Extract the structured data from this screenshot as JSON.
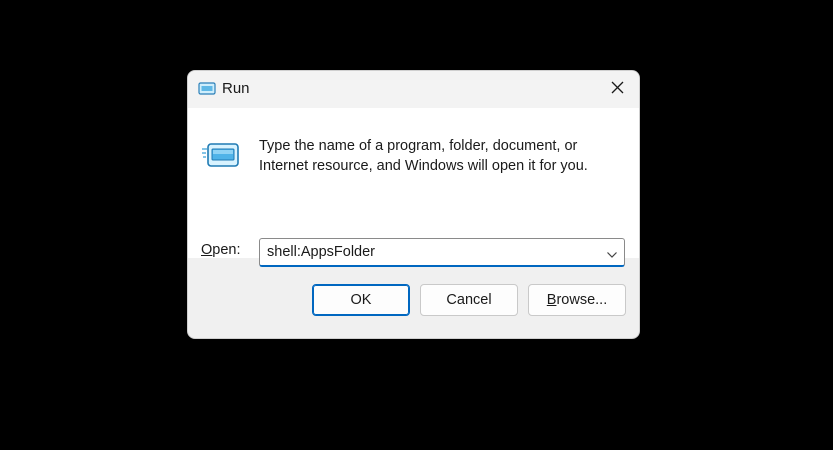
{
  "window": {
    "title": "Run",
    "title_icon": "run-app-icon",
    "close_icon": "close-icon"
  },
  "content": {
    "icon": "run-app-icon",
    "description": "Type the name of a program, folder, document, or Internet resource, and Windows will open it for you.",
    "open_label_accel": "O",
    "open_label_rest": "pen:",
    "input_value": "shell:AppsFolder",
    "dropdown_icon": "chevron-down-icon"
  },
  "buttons": {
    "ok": "OK",
    "cancel": "Cancel",
    "browse_accel": "B",
    "browse_rest": "rowse..."
  },
  "colors": {
    "accent": "#0067c0",
    "background": "#000000",
    "dialog_bg": "#f0f0f0",
    "content_bg": "#ffffff"
  }
}
